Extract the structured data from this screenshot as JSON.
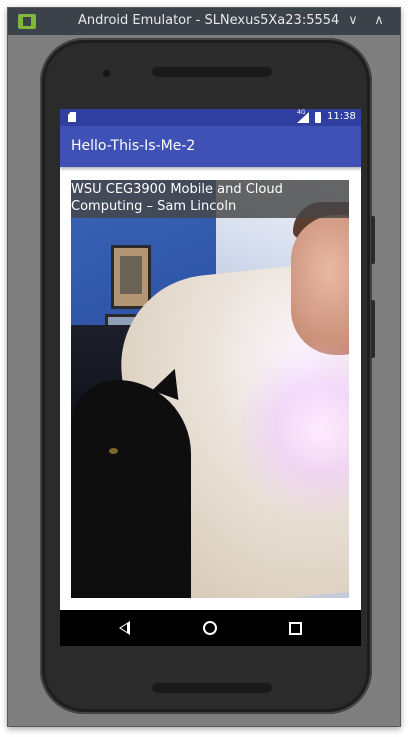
{
  "window": {
    "title": "Android Emulator - SLNexus5Xa23:5554",
    "minimize_glyph": "∨",
    "maximize_glyph": "∧"
  },
  "status_bar": {
    "network_label": "4G",
    "time": "11:38"
  },
  "app_bar": {
    "title": "Hello-This-Is-Me-2"
  },
  "photo": {
    "caption": "WSU CEG3900 Mobile and Cloud Computing – Sam Lincoln"
  },
  "colors": {
    "status_bar": "#303f9f",
    "app_bar": "#3f51b5",
    "nav_bar": "#000000",
    "title_bar": "#3c4249"
  }
}
